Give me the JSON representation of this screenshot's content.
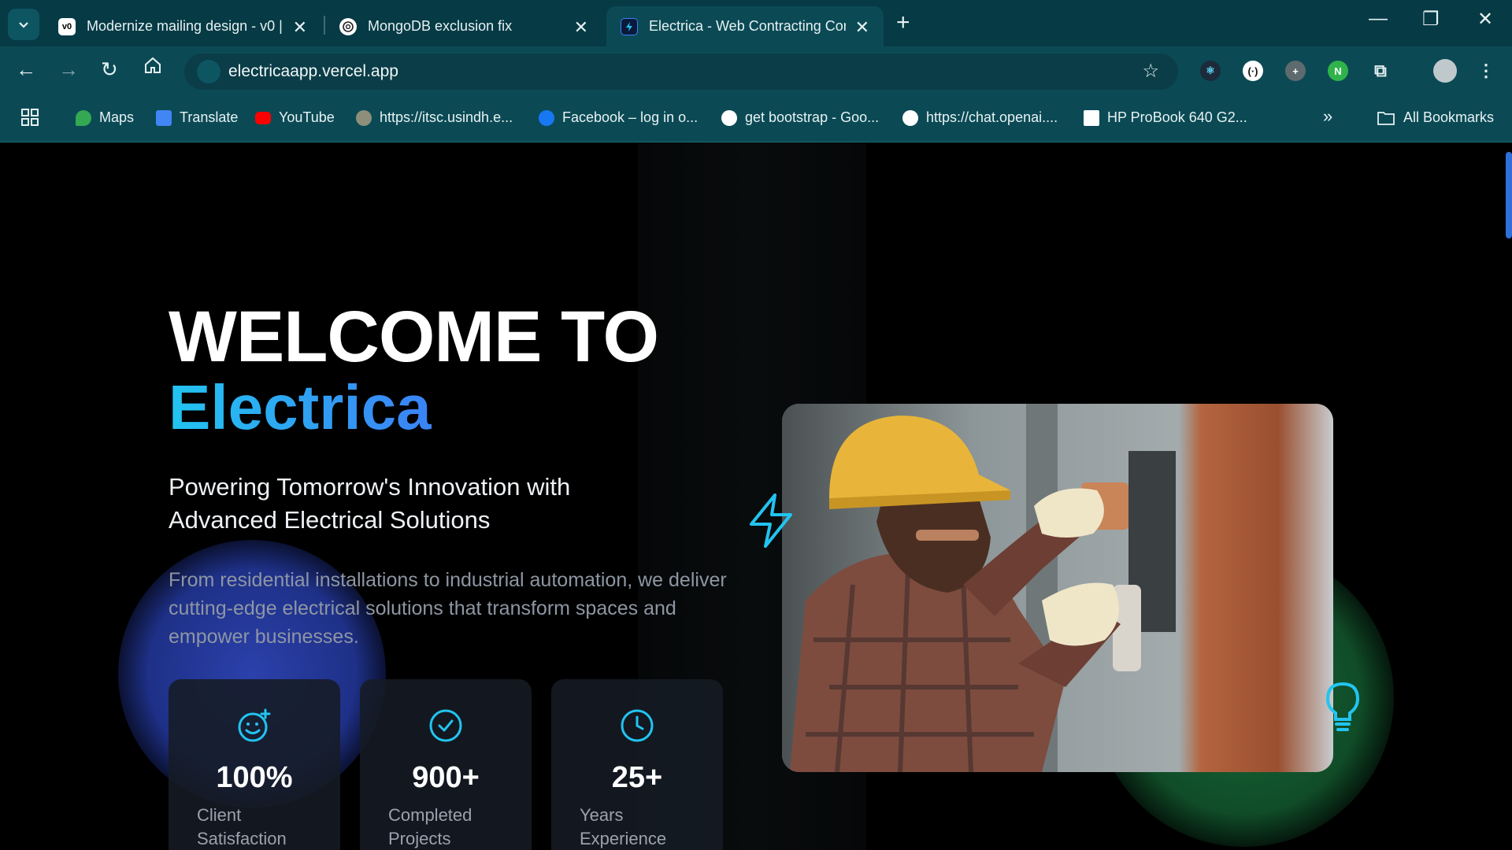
{
  "browser": {
    "tabs": [
      {
        "title": "Modernize mailing design - v0 |",
        "favicon": "v0-icon"
      },
      {
        "title": "MongoDB exclusion fix",
        "favicon": "openai-icon"
      },
      {
        "title": "Electrica - Web Contracting Cor",
        "favicon": "electrica-icon"
      }
    ],
    "url": "electricaapp.vercel.app",
    "bookmarks": [
      {
        "label": "Maps",
        "icon": "maps-icon"
      },
      {
        "label": "Translate",
        "icon": "translate-icon"
      },
      {
        "label": "YouTube",
        "icon": "youtube-icon"
      },
      {
        "label": "https://itsc.usindh.e...",
        "icon": "site-icon"
      },
      {
        "label": "Facebook – log in o...",
        "icon": "facebook-icon"
      },
      {
        "label": "get bootstrap - Goo...",
        "icon": "globe-icon"
      },
      {
        "label": "https://chat.openai....",
        "icon": "openai-icon"
      },
      {
        "label": "HP ProBook 640 G2...",
        "icon": "page-icon"
      }
    ],
    "all_bookmarks": "All Bookmarks",
    "colors": {
      "frame": "#063a45",
      "toolbar": "#0b4a55"
    }
  },
  "hero": {
    "welcome": "WELCOME TO",
    "brand": "Electrica",
    "subtitle": "Powering Tomorrow's Innovation with Advanced Electrical Solutions",
    "description": "From residential installations to industrial automation, we deliver cutting-edge electrical solutions that transform spaces and empower businesses.",
    "accent_color": "#22c4f0"
  },
  "stats": [
    {
      "icon": "smile-plus-icon",
      "value": "100%",
      "label": "Client Satisfaction"
    },
    {
      "icon": "check-circle-icon",
      "value": "900+",
      "label": "Completed Projects"
    },
    {
      "icon": "clock-icon",
      "value": "25+",
      "label": "Years Experience"
    }
  ]
}
